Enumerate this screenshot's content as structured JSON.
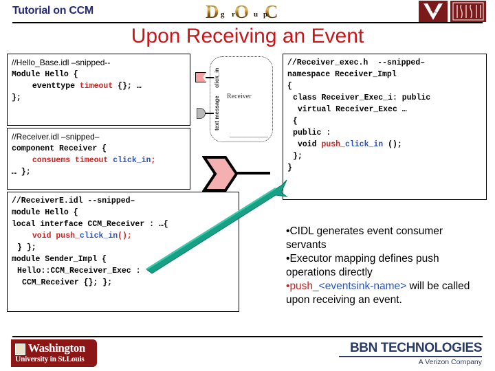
{
  "header": {
    "title": "Tutorial on CCM",
    "doc_logo": {
      "letters": [
        "D",
        "O",
        "C"
      ],
      "subletters": [
        "g",
        "r",
        "u",
        "p"
      ],
      "alt": "DOC Group logo"
    },
    "vu_logo": {
      "text": "V",
      "alt": "Vanderbilt University logo"
    },
    "isis_logo": {
      "text": "ISIS",
      "alt": "ISIS logo"
    }
  },
  "slide": {
    "title": "Upon Receiving an Event"
  },
  "code_boxes": {
    "hello_base": {
      "comment": "//Hello_Base.idl –snipped--",
      "lines": [
        {
          "segments": [
            {
              "text": "Module Hello {",
              "style": "kw"
            }
          ],
          "indent": ""
        },
        {
          "segments": [
            {
              "text": "eventtype ",
              "style": "kw"
            },
            {
              "text": "timeout",
              "style": "red"
            },
            {
              "text": " {}; …",
              "style": "kw"
            }
          ],
          "indent": "ind1"
        },
        {
          "segments": [
            {
              "text": "};",
              "style": "kw"
            }
          ],
          "indent": ""
        }
      ]
    },
    "receiver_idl": {
      "comment": "//Receiver.idl –snipped–",
      "lines": [
        {
          "segments": [
            {
              "text": "component Receiver {",
              "style": "kw"
            }
          ],
          "indent": ""
        },
        {
          "segments": [
            {
              "text": "consuems timeout ",
              "style": "red"
            },
            {
              "text": "click_in",
              "style": "blue"
            },
            {
              "text": ";",
              "style": "red"
            }
          ],
          "indent": "ind1"
        },
        {
          "segments": [
            {
              "text": "… };",
              "style": "kw"
            }
          ],
          "indent": ""
        }
      ]
    },
    "receiverE_idl": {
      "comment": "//ReceiverE.idl --snipped–",
      "lines": [
        {
          "segments": [
            {
              "text": "module Hello {",
              "style": "kw"
            }
          ],
          "indent": ""
        },
        {
          "segments": [
            {
              "text": "local interface CCM_Receiver : …{",
              "style": "kw"
            }
          ],
          "indent": ""
        },
        {
          "segments": [
            {
              "text": "void push_",
              "style": "red"
            },
            {
              "text": "click_in",
              "style": "blue"
            },
            {
              "text": "();",
              "style": "red"
            }
          ],
          "indent": "ind1"
        },
        {
          "segments": [
            {
              "text": "} };",
              "style": "kw"
            }
          ],
          "indent": "ind05"
        },
        {
          "segments": [
            {
              "text": "module Sender_Impl {",
              "style": "kw"
            }
          ],
          "indent": ""
        },
        {
          "segments": [
            {
              "text": "Hello::CCM_Receiver_Exec :",
              "style": "kw"
            }
          ],
          "indent": "ind05"
        },
        {
          "segments": [
            {
              "text": "CCM_Receiver {}; };",
              "style": "kw"
            }
          ],
          "indent": "ind2"
        }
      ]
    },
    "receiver_exec_h": {
      "comment": "//Receiver_exec.h  --snipped–",
      "lines": [
        {
          "segments": [
            {
              "text": "namespace Receiver_Impl",
              "style": "kw"
            }
          ],
          "indent": ""
        },
        {
          "segments": [
            {
              "text": "{",
              "style": "kw"
            }
          ],
          "indent": ""
        },
        {
          "segments": [
            {
              "text": "class Receiver_Exec_i: public",
              "style": "kw"
            }
          ],
          "indent": "ind05"
        },
        {
          "segments": [
            {
              "text": "virtual Receiver_Exec …",
              "style": "kw"
            }
          ],
          "indent": "ind2"
        },
        {
          "segments": [
            {
              "text": "{",
              "style": "kw"
            }
          ],
          "indent": "ind05"
        },
        {
          "segments": [
            {
              "text": "public :",
              "style": "kw"
            }
          ],
          "indent": "ind05"
        },
        {
          "segments": [
            {
              "text": "void ",
              "style": "kw"
            },
            {
              "text": "push_",
              "style": "red"
            },
            {
              "text": "click_in",
              "style": "blue"
            },
            {
              "text": " ();",
              "style": "kw"
            }
          ],
          "indent": "ind2"
        },
        {
          "segments": [
            {
              "text": "};",
              "style": "kw"
            }
          ],
          "indent": "ind05"
        },
        {
          "segments": [
            {
              "text": "}",
              "style": "kw"
            }
          ],
          "indent": ""
        }
      ]
    }
  },
  "diagram": {
    "component_name": "Receiver",
    "port_click_label": "click_in",
    "port_message_label": "text message"
  },
  "bullets": [
    {
      "marker": "•",
      "segments": [
        {
          "text": "CIDL generates event consumer servants",
          "style": ""
        }
      ]
    },
    {
      "marker": "•",
      "segments": [
        {
          "text": "Executor mapping defines push operations directly",
          "style": ""
        }
      ]
    },
    {
      "marker": "•",
      "segments": [
        {
          "text": "push_",
          "style": "b-red"
        },
        {
          "text": "<eventsink-name>",
          "style": "b-blue"
        },
        {
          "text": " will be called upon receiving an event.",
          "style": ""
        }
      ]
    }
  ],
  "footer": {
    "wustl": {
      "name": "Washington",
      "sub": "University in St.Louis"
    },
    "bbn": {
      "name": "BBN TECHNOLOGIES",
      "sub": "A Verizon Company"
    }
  },
  "colors": {
    "title_red": "#cc1417",
    "header_navy": "#252a7a",
    "code_red": "#cc2222",
    "code_blue": "#2a52be",
    "logo_maroon": "#7b1a1a",
    "wustl_red": "#8c1515",
    "bbn_navy": "#2a3c63",
    "arrow_green": "#16a085",
    "sink_pink": "#f4b0b0"
  }
}
